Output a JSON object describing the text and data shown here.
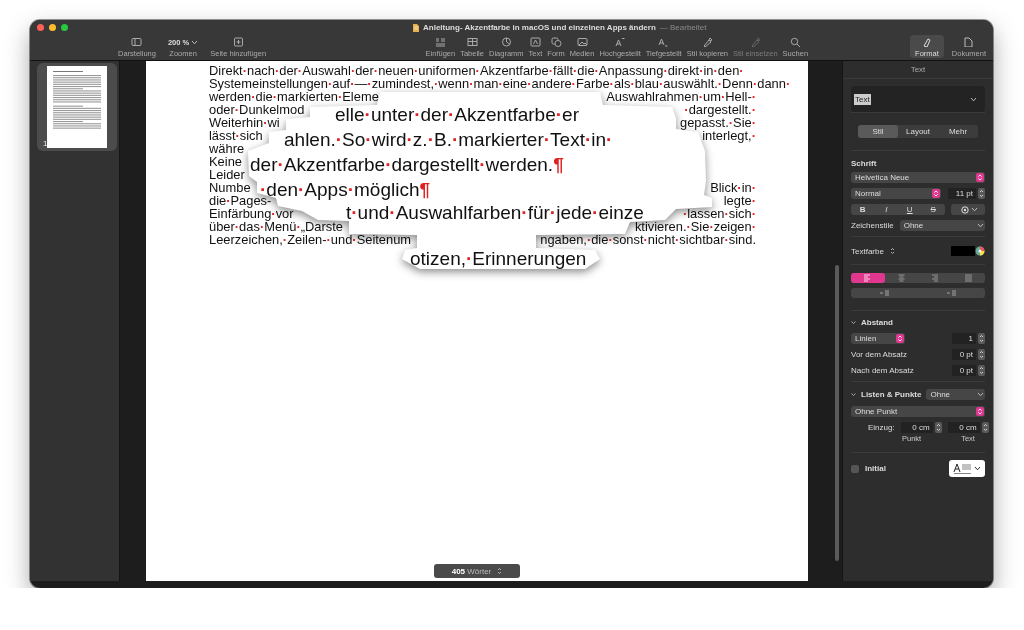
{
  "window": {
    "title": "Anleitung- Akzentfarbe in macOS und einzelnen Apps ändern",
    "status": "— Bearbeitet"
  },
  "toolbar": [
    {
      "label": "Darstellung",
      "kind": "sidebar",
      "disabled": false
    },
    {
      "label": "Zoomen",
      "kind": "zoom",
      "value": "200 %",
      "disabled": false
    },
    {
      "label": "Seite hinzufügen",
      "kind": "addpage",
      "disabled": false
    },
    {
      "label": "Einfügen",
      "kind": "insert",
      "disabled": false
    },
    {
      "label": "Tabelle",
      "kind": "table",
      "disabled": false
    },
    {
      "label": "Diagramm",
      "kind": "chart",
      "disabled": false
    },
    {
      "label": "Text",
      "kind": "text",
      "disabled": false
    },
    {
      "label": "Form",
      "kind": "shape",
      "disabled": false
    },
    {
      "label": "Medien",
      "kind": "media",
      "disabled": false
    },
    {
      "label": "Hochgestellt",
      "kind": "superscript",
      "disabled": false
    },
    {
      "label": "Tiefgestellt",
      "kind": "subscript",
      "disabled": false
    },
    {
      "label": "Stil kopieren",
      "kind": "copystyle",
      "disabled": false
    },
    {
      "label": "Stil einsetzen",
      "kind": "pastestyle",
      "disabled": true
    },
    {
      "label": "Suchen",
      "kind": "search",
      "disabled": false
    }
  ],
  "inspector_tabs": [
    {
      "label": "Format",
      "kind": "format",
      "selected": true
    },
    {
      "label": "Dokument",
      "kind": "document",
      "selected": false
    }
  ],
  "thumbnails": [
    {
      "page": "1",
      "selected": true
    }
  ],
  "document": {
    "lines": [
      {
        "left": "Direkt·nach·der·Auswahl·der·neuen·uniformen·Akzentfarbe·fällt·die·Anpassung·direkt·in·den·"
      },
      {
        "left": "Systemeinstellungen·auf·—·zumindest,·wenn·man·eine·andere·Farbe·als·blau·auswählt.·Denn·dann·"
      },
      {
        "left": "werden·die·markierten·Eleme",
        "right": "Auswahlrahmen·um·Hell-·"
      },
      {
        "left": "oder·Dunkelmod",
        "right": "·dargestellt.·"
      },
      {
        "left": "Weiterhin·wi",
        "right": "gepasst.·Sie·"
      },
      {
        "left": "lässt·sich",
        "right": "interlegt,·"
      },
      {
        "left": "währe"
      },
      {
        "left": "Keine"
      },
      {
        "left": "Leider"
      },
      {
        "left": "Numbe",
        "right": "Blick·in·"
      },
      {
        "left": "die·Pages-",
        "right": "legte·"
      },
      {
        "left": "Einfärbung·vor",
        "right": "·lassen·sich·"
      },
      {
        "left": "über·das·Menü·„Darste",
        "right": "ktivieren.·Sie·zeigen·"
      },
      {
        "left": "Leerzeichen,·Zeilen-·und·Seitenum",
        "right": "ngaben,·die·sonst·nicht·sichtbar·sind."
      }
    ],
    "magnifier": [
      "elle·unter·der·Akzentfarbe·er",
      "ahlen.·So·wird·z.·B.·markierter·Text·in·",
      "der·Akzentfarbe·dargestellt·werden.¶",
      "·den·Apps·möglich¶",
      "t·und·Auswahlfarben·für·jede·einze",
      "otizen,·Erinnerungen"
    ]
  },
  "word_count": "**405** Wörter",
  "inspector": {
    "title": "Text",
    "paragraph_style": "Text",
    "tabs": [
      {
        "label": "Stil",
        "selected": true
      },
      {
        "label": "Layout",
        "selected": false
      },
      {
        "label": "Mehr",
        "selected": false
      }
    ],
    "font": {
      "heading": "Schrift",
      "family": "Helvetica Neue",
      "typeface": "Normal",
      "size": "11 pt",
      "styles": [
        {
          "label": "B",
          "kind": "bold",
          "on": false
        },
        {
          "label": "I",
          "kind": "italic",
          "on": false
        },
        {
          "label": "U",
          "kind": "underline",
          "on": false
        },
        {
          "label": "S",
          "kind": "strike",
          "on": false
        }
      ]
    },
    "character_styles": {
      "label": "Zeichenstile",
      "value": "Ohne"
    },
    "text_color": {
      "label": "Textfarbe"
    },
    "alignment": [
      {
        "kind": "left",
        "selected": true
      },
      {
        "kind": "center",
        "selected": false
      },
      {
        "kind": "right",
        "selected": false
      },
      {
        "kind": "justify",
        "selected": false
      }
    ],
    "spacing": {
      "heading": "Abstand",
      "expanded": true,
      "mode": "Linien",
      "value": "1",
      "before_label": "Vor dem Absatz",
      "before": "0 pt",
      "after_label": "Nach dem Absatz",
      "after": "0 pt"
    },
    "lists": {
      "heading": "Listen & Punkte",
      "expanded": true,
      "value": "Ohne",
      "bullet": "Ohne Punkt",
      "indent_label": "Einzug:",
      "bullet_indent": "0 cm",
      "text_indent": "0 cm",
      "bullet_caption": "Punkt",
      "text_caption": "Text"
    },
    "initial": {
      "label": "Initial",
      "checked": false
    }
  }
}
